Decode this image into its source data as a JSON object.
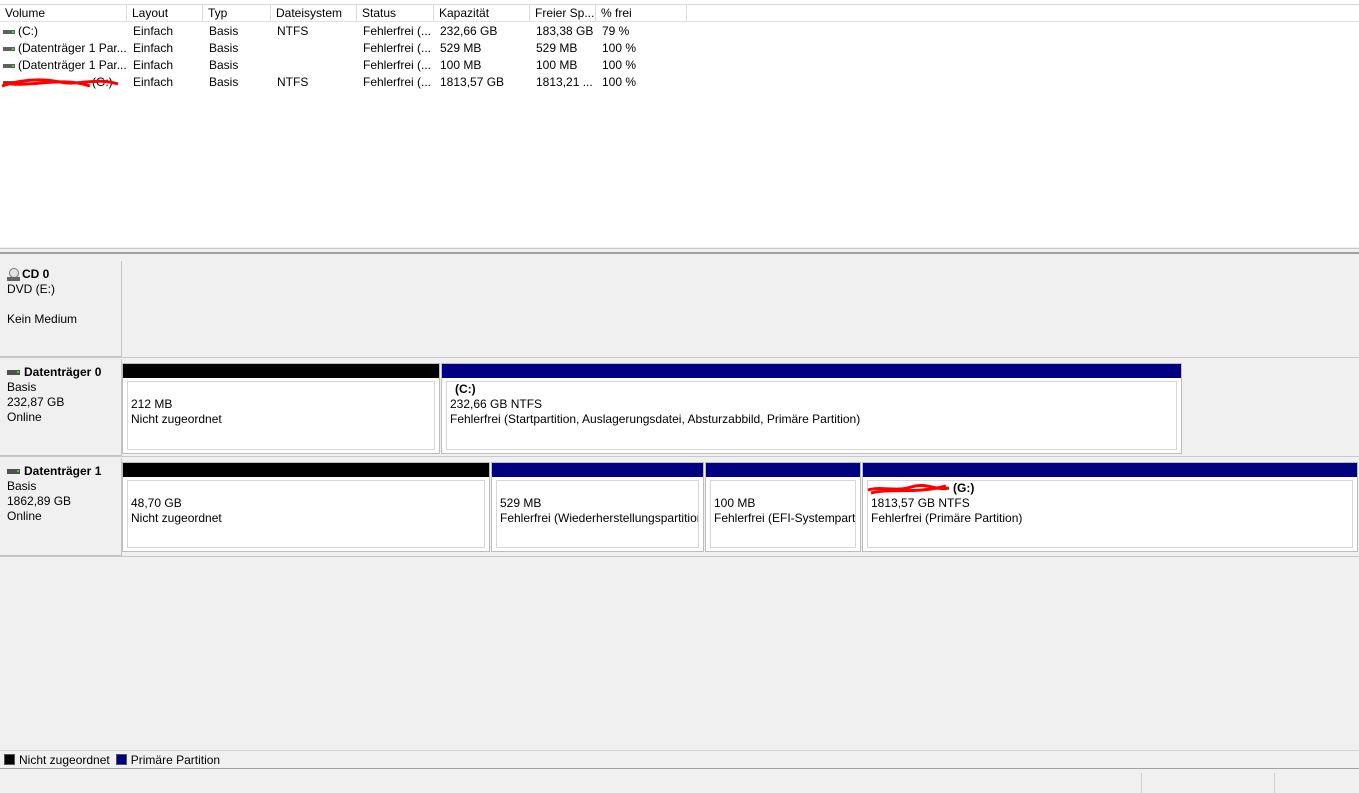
{
  "volume_list": {
    "columns": [
      "Volume",
      "Layout",
      "Typ",
      "Dateisystem",
      "Status",
      "Kapazität",
      "Freier Sp...",
      "% frei"
    ],
    "rows": [
      {
        "volume": " (C:)",
        "layout": "Einfach",
        "typ": "Basis",
        "fs": "NTFS",
        "status": "Fehlerfrei (...",
        "kap": "232,66 GB",
        "frei": "183,38 GB",
        "pct": "79 %"
      },
      {
        "volume": "(Datenträger 1 Par...",
        "layout": "Einfach",
        "typ": "Basis",
        "fs": "",
        "status": "Fehlerfrei (...",
        "kap": "529 MB",
        "frei": "529 MB",
        "pct": "100 %"
      },
      {
        "volume": "(Datenträger 1 Par...",
        "layout": "Einfach",
        "typ": "Basis",
        "fs": "",
        "status": "Fehlerfrei (...",
        "kap": "100 MB",
        "frei": "100 MB",
        "pct": "100 %"
      },
      {
        "volume": "(G:)",
        "layout": "Einfach",
        "typ": "Basis",
        "fs": "NTFS",
        "status": "Fehlerfrei (...",
        "kap": "1813,57 GB",
        "frei": "1813,21 ...",
        "pct": "100 %"
      }
    ]
  },
  "disks": {
    "cd0": {
      "name": "CD 0",
      "line1": "DVD (E:)",
      "line2": "",
      "line3": "Kein Medium"
    },
    "disk0": {
      "name": "Datenträger 0",
      "type": "Basis",
      "size": "232,87 GB",
      "state": "Online",
      "partitions": [
        {
          "name": "",
          "size": "212 MB",
          "status": "Nicht zugeordnet"
        },
        {
          "name": "(C:)",
          "size": "232,66 GB NTFS",
          "status": "Fehlerfrei (Startpartition, Auslagerungsdatei, Absturzabbild, Primäre Partition)"
        }
      ]
    },
    "disk1": {
      "name": "Datenträger 1",
      "type": "Basis",
      "size": "1862,89 GB",
      "state": "Online",
      "partitions": [
        {
          "name": "",
          "size": "48,70 GB",
          "status": "Nicht zugeordnet"
        },
        {
          "name": "",
          "size": "529 MB",
          "status": "Fehlerfrei (Wiederherstellungspartition)"
        },
        {
          "name": "",
          "size": "100 MB",
          "status": "Fehlerfrei (EFI-Systempartition)"
        },
        {
          "name": "(G:)",
          "size": "1813,57 GB NTFS",
          "status": "Fehlerfrei (Primäre Partition)"
        }
      ]
    }
  },
  "legend": {
    "unallocated": "Nicht zugeordnet",
    "primary": "Primäre Partition"
  },
  "colors": {
    "unallocated": "#000000",
    "primary": "#000080",
    "redaction": "#ff0000"
  }
}
